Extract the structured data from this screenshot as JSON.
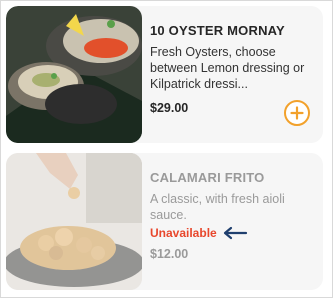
{
  "items": [
    {
      "title": "10 OYSTER MORNAY",
      "description": "Fresh Oysters, choose between Lemon dressing or Kilpatrick dressi...",
      "price": "$29.00",
      "image_icon": "oysters-photo",
      "add_icon": "plus-icon"
    },
    {
      "title": "CALAMARI FRITO",
      "description": "A classic, with fresh aioli sauce.",
      "status": "Unavailable",
      "price": "$12.00",
      "image_icon": "calamari-photo",
      "status_arrow_icon": "arrow-left-icon"
    }
  ],
  "colors": {
    "accent": "#f2a12b",
    "unavailable": "#e8472c",
    "arrow": "#1f3f6e"
  }
}
